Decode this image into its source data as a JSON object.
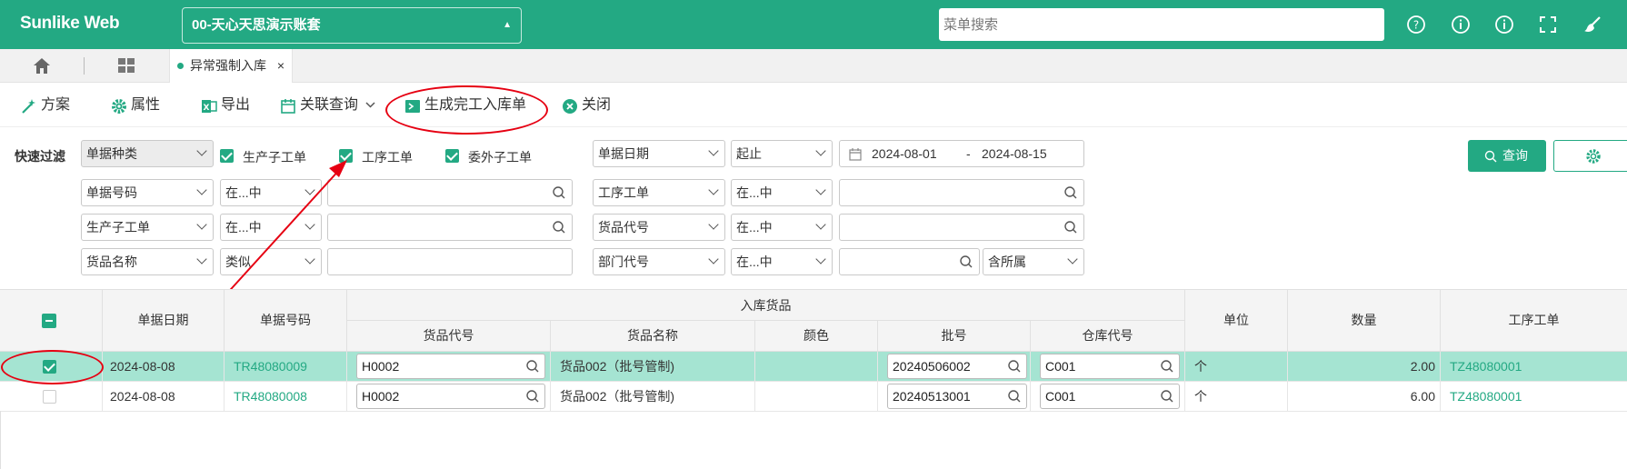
{
  "app": {
    "name": "Sunlike Web",
    "account": "00-天心天思演示账套",
    "search_placeholder": "菜单搜索"
  },
  "topbar_icons": [
    "help-icon",
    "info-icon",
    "info-icon",
    "fullscreen-icon",
    "brush-icon"
  ],
  "tabs": {
    "active": "异常强制入库"
  },
  "toolbar": {
    "scheme": "方案",
    "props": "属性",
    "export": "导出",
    "related": "关联查询",
    "generate": "生成完工入库单",
    "close": "关闭"
  },
  "filter": {
    "label": "快速过滤",
    "doc_type": "单据种类",
    "checks": [
      "生产子工单",
      "工序工单",
      "委外子工单"
    ],
    "doc_no": "单据号码",
    "op1": "在...中",
    "sub_order": "生产子工单",
    "op2": "在...中",
    "goods_name": "货品名称",
    "op3": "类似",
    "doc_date": "单据日期",
    "range": "起止",
    "date_from": "2024-08-01",
    "date_sep": "-",
    "date_to": "2024-08-15",
    "proc_order": "工序工单",
    "op4": "在...中",
    "goods_code": "货品代号",
    "op5": "在...中",
    "dept_code": "部门代号",
    "op6": "在...中",
    "sub_incl": "含所属",
    "query": "查询"
  },
  "table": {
    "headers": {
      "date": "单据日期",
      "no": "单据号码",
      "group": "入库货品",
      "code": "货品代号",
      "name": "货品名称",
      "color": "颜色",
      "batch": "批号",
      "wh": "仓库代号",
      "unit": "单位",
      "qty": "数量",
      "proc": "工序工单"
    },
    "rows": [
      {
        "checked": true,
        "date": "2024-08-08",
        "no": "TR48080009",
        "code": "H0002",
        "name": "货品002（批号管制)",
        "color": "",
        "batch": "20240506002",
        "wh": "C001",
        "unit": "个",
        "qty": "2.00",
        "proc": "TZ48080001"
      },
      {
        "checked": false,
        "date": "2024-08-08",
        "no": "TR48080008",
        "code": "H0002",
        "name": "货品002（批号管制)",
        "color": "",
        "batch": "20240513001",
        "wh": "C001",
        "unit": "个",
        "qty": "6.00",
        "proc": "TZ48080001"
      }
    ]
  },
  "colors": {
    "accent": "#23a983",
    "selected_row": "#a5e4d2",
    "annotation": "#e60012"
  }
}
